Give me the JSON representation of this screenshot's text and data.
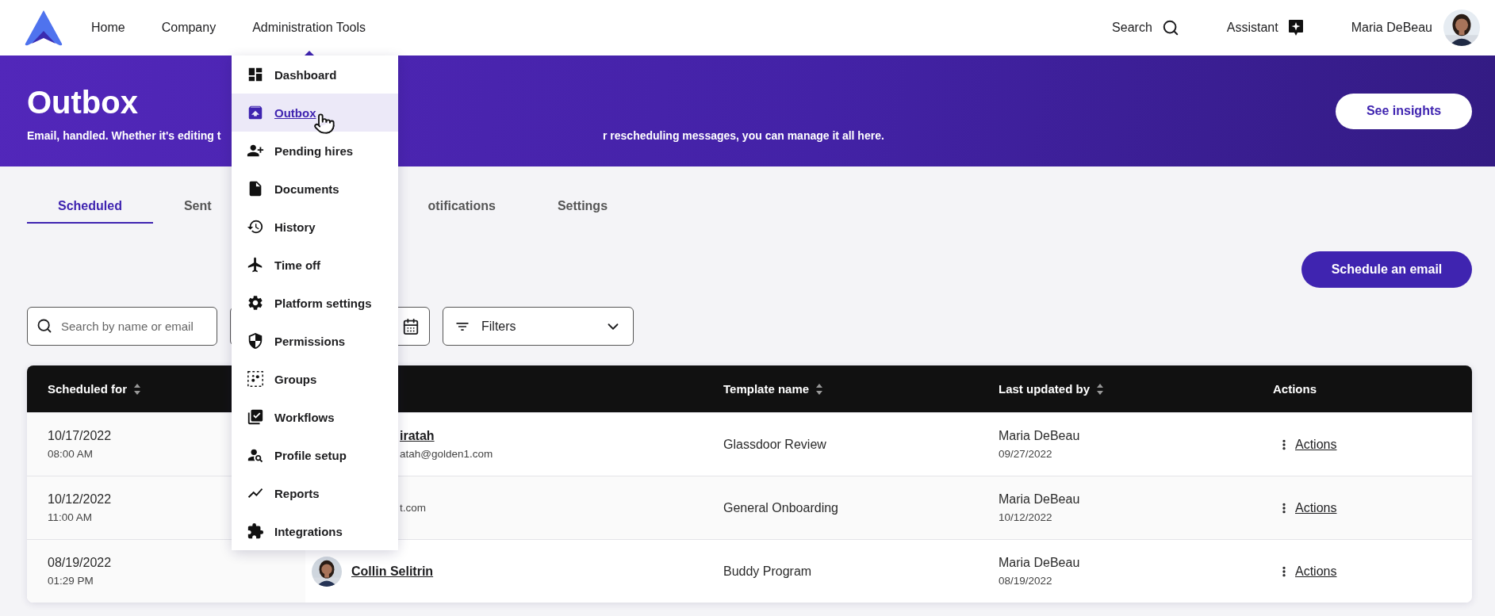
{
  "nav": {
    "links": [
      {
        "label": "Home",
        "selected": false
      },
      {
        "label": "Company",
        "selected": false
      },
      {
        "label": "Administration Tools",
        "selected": true
      }
    ],
    "search_label": "Search",
    "assistant_label": "Assistant",
    "user_name": "Maria DeBeau"
  },
  "hero": {
    "title": "Outbox",
    "subtitle_parts": [
      "Email, handled. Whether it's editing t",
      "r rescheduling messages, you can manage it all here."
    ],
    "button": "See insights"
  },
  "tabs": [
    {
      "label": "Scheduled",
      "selected": true
    },
    {
      "label": "Sent",
      "selected": false
    },
    {
      "label": "otifications",
      "selected": false
    },
    {
      "label": "Settings",
      "selected": false
    }
  ],
  "primary_button": "Schedule an email",
  "filters": {
    "search": {
      "placeholder": "Search by name or email"
    },
    "filter": {
      "label": "Filters"
    }
  },
  "table": {
    "columns": [
      {
        "label": "Scheduled for",
        "sortable": true
      },
      {
        "label": "Template name",
        "sortable": true
      },
      {
        "label": "Last updated by",
        "sortable": true
      },
      {
        "label": "Actions",
        "sortable": false
      }
    ],
    "rows": [
      {
        "date": "10/17/2022",
        "time": "08:00 AM",
        "recipient": {
          "kind": "partial",
          "name": "iratah",
          "email": "atah@golden1.com"
        },
        "template": "Glassdoor Review",
        "updated_by": "Maria DeBeau",
        "updated_on": "09/27/2022",
        "action": "Actions"
      },
      {
        "date": "10/12/2022",
        "time": "11:00 AM",
        "recipient": {
          "kind": "partial",
          "email": "t.com"
        },
        "template": "General Onboarding",
        "updated_by": "Maria DeBeau",
        "updated_on": "10/12/2022",
        "action": "Actions"
      },
      {
        "date": "08/19/2022",
        "time": "01:29 PM",
        "recipient": {
          "kind": "avatar",
          "name": "Collin Selitrin"
        },
        "template": "Buddy Program",
        "updated_by": "Maria DeBeau",
        "updated_on": "08/19/2022",
        "action": "Actions"
      }
    ]
  },
  "menu": {
    "items": [
      {
        "label": "Dashboard",
        "selected": false
      },
      {
        "label": "Outbox",
        "selected": true
      },
      {
        "label": "Pending hires",
        "selected": false
      },
      {
        "label": "Documents",
        "selected": false
      },
      {
        "label": "History",
        "selected": false
      },
      {
        "label": "Time off",
        "selected": false
      },
      {
        "label": "Platform settings",
        "selected": false
      },
      {
        "label": "Permissions",
        "selected": false
      },
      {
        "label": "Groups",
        "selected": false
      },
      {
        "label": "Workflows",
        "selected": false
      },
      {
        "label": "Profile setup",
        "selected": false
      },
      {
        "label": "Reports",
        "selected": false
      },
      {
        "label": "Integrations",
        "selected": false
      }
    ]
  }
}
